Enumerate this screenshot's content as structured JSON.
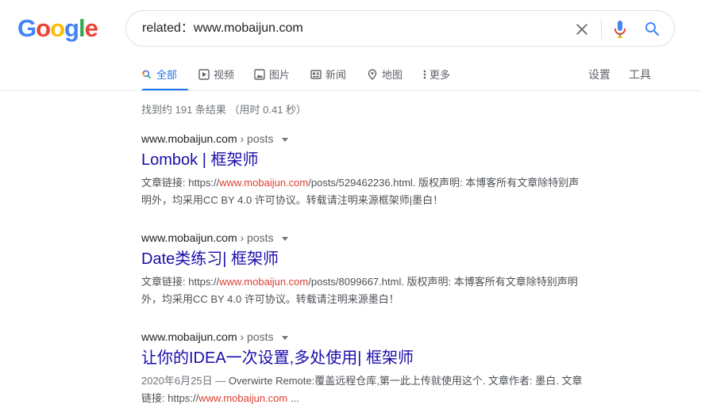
{
  "logo": {
    "letters": [
      "G",
      "o",
      "o",
      "g",
      "l",
      "e"
    ],
    "colors": [
      "#4285f4",
      "#ea4335",
      "#fbbc05",
      "#4285f4",
      "#34a853",
      "#ea4335"
    ]
  },
  "search": {
    "value": "related：www.mobaijun.com",
    "clear_icon": "close-icon",
    "mic_icon": "mic-icon",
    "search_icon": "search-icon"
  },
  "tabs": [
    {
      "label": "全部",
      "icon": "search-icon",
      "active": true
    },
    {
      "label": "视频",
      "icon": "video-icon"
    },
    {
      "label": "图片",
      "icon": "image-icon"
    },
    {
      "label": "新闻",
      "icon": "news-icon"
    },
    {
      "label": "地图",
      "icon": "map-pin-icon"
    },
    {
      "label": "更多",
      "icon": "more-vert-icon"
    }
  ],
  "tools": {
    "settings": "设置",
    "tools": "工具"
  },
  "stats": "找到约 191 条结果 （用时 0.41 秒）",
  "results": [
    {
      "site": "www.mobaijun.com",
      "path": " › posts",
      "title": "Lombok | 框架师",
      "snippet_pre": "文章链接: https://",
      "snippet_hl": "www.mobaijun.com",
      "snippet_post_1": "/posts/529462236.html. 版权声明: 本博客所有文章除特别声",
      "snippet_post_2": "明外，均采用CC BY 4.0 许可协议。转载请注明来源框架师|墨白！"
    },
    {
      "site": "www.mobaijun.com",
      "path": " › posts",
      "title": "Date类练习| 框架师",
      "snippet_pre": "文章链接: https://",
      "snippet_hl": "www.mobaijun.com",
      "snippet_post_1": "/posts/8099667.html. 版权声明: 本博客所有文章除特别声明",
      "snippet_post_2": "外，均采用CC BY 4.0 许可协议。转载请注明来源墨白！"
    },
    {
      "site": "www.mobaijun.com",
      "path": " › posts",
      "title": "让你的IDEA一次设置,多处使用| 框架师",
      "date": "2020年6月25日 — ",
      "snippet_line1": "Overwirte Remote:覆盖远程仓库,第一此上传就使用这个. 文章作者: 墨白. 文章",
      "snippet_pre": "链接: https://",
      "snippet_hl": "www.mobaijun.com",
      "snippet_post": " ..."
    }
  ]
}
